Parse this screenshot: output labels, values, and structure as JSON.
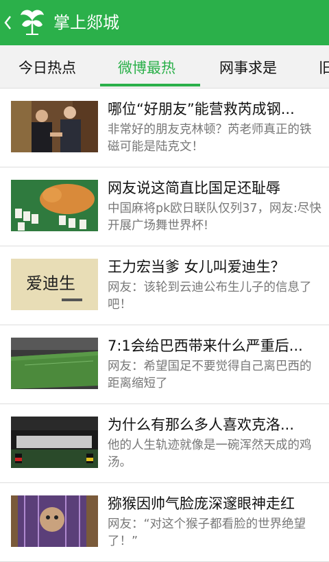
{
  "header": {
    "back_icon": "chevron-left-icon",
    "logo_icon": "ginkgo-leaf-logo-icon",
    "title": "掌上郯城",
    "color": "#2bb04a"
  },
  "tabs": [
    {
      "label": "今日热点",
      "active": false
    },
    {
      "label": "微博最热",
      "active": true
    },
    {
      "label": "网事求是",
      "active": false
    },
    {
      "label": "旧",
      "active": false
    }
  ],
  "articles": [
    {
      "title": "哪位“好朋友”能营救芮成钢...",
      "summary": "非常好的朋友克林顿？芮老师真正的铁磁可能是陆克文！",
      "thumb_icon": "two-men-handshake-photo"
    },
    {
      "title": "网友说这简直比国足还耻辱",
      "summary": "中国麻将pk欧日联队仅列37，网友:尽快开展广场舞世界杯!",
      "thumb_icon": "cat-on-mahjong-photo"
    },
    {
      "title": "王力宏当爹 女儿叫爱迪生？",
      "summary": "网友：该轮到云迪公布生儿子的信息了吧！",
      "thumb_icon": "calligraphy-photo",
      "thumb_text": "爱迪生"
    },
    {
      "title": "7:1会给巴西带来什么严重后...",
      "summary": "网友：希望国足不要觉得自己离巴西的距离缩短了",
      "thumb_icon": "stadium-photo"
    },
    {
      "title": "为什么有那么多人喜欢克洛...",
      "summary": "他的人生轨迹就像是一碗浑然天成的鸡汤。",
      "thumb_icon": "fans-banner-photo"
    },
    {
      "title": "猕猴因帅气脸庞深邃眼神走红",
      "summary": "网友：“对这个猴子都看脸的世界绝望了！”",
      "thumb_icon": "monkey-cage-photo"
    }
  ]
}
